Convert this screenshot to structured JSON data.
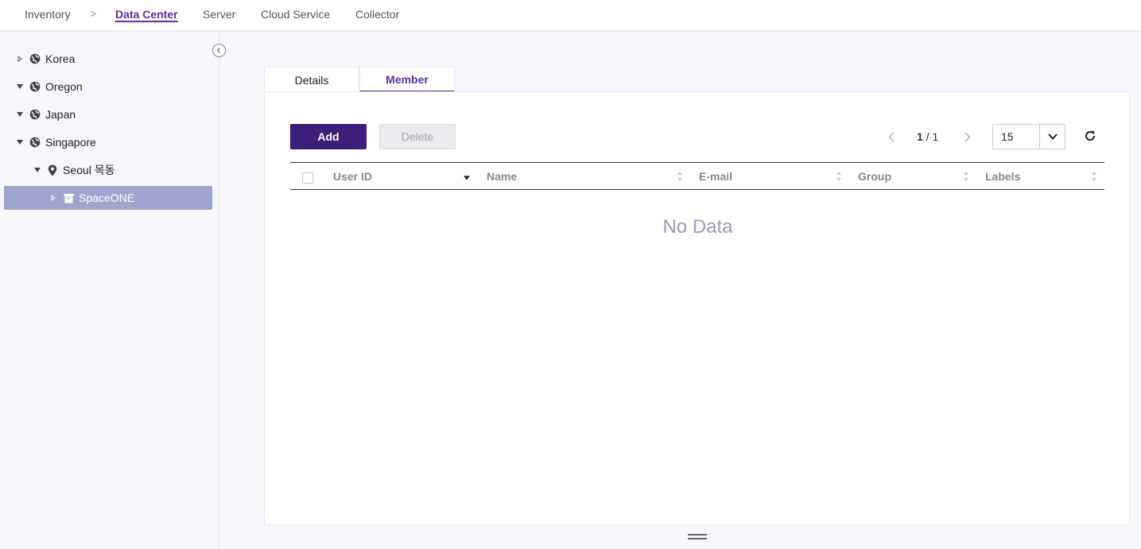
{
  "topnav": {
    "items": [
      "Inventory",
      "Data Center",
      "Server",
      "Cloud Service",
      "Collector"
    ],
    "separator": ">",
    "active_color": "#5b2d9e"
  },
  "sidebar": {
    "tree": [
      {
        "label": "Korea",
        "expanded": false,
        "icon": "globe-icon"
      },
      {
        "label": "Oregon",
        "expanded": true,
        "icon": "globe-icon"
      },
      {
        "label": "Japan",
        "expanded": true,
        "icon": "globe-icon"
      },
      {
        "label": "Singapore",
        "expanded": true,
        "icon": "globe-icon"
      },
      {
        "label": "Seoul 목동",
        "expanded": true,
        "icon": "location-pin-icon"
      },
      {
        "label": "SpaceONE",
        "expanded": false,
        "icon": "archive-box-icon",
        "selected": true
      }
    ],
    "selected_bg": "#a0a4cf"
  },
  "tabs": [
    {
      "label": "Details",
      "active": false
    },
    {
      "label": "Member",
      "active": true
    }
  ],
  "toolbar": {
    "add_label": "Add",
    "delete_label": "Delete",
    "add_color": "#3c1f78"
  },
  "pagination": {
    "current": "1",
    "total": "/ 1",
    "page_size": "15"
  },
  "table": {
    "columns": [
      "User ID",
      "Name",
      "E-mail",
      "Group",
      "Labels"
    ],
    "empty_text": "No Data"
  }
}
